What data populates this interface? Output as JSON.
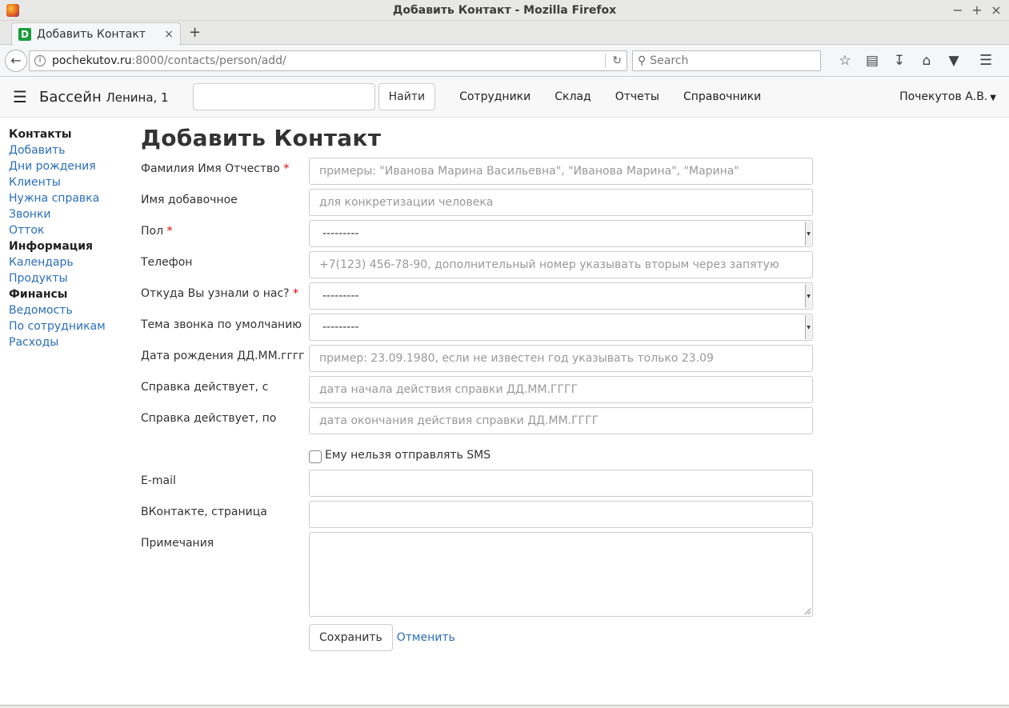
{
  "window": {
    "title": "Добавить Контакт - Mozilla Firefox",
    "controls": {
      "minimize": "−",
      "maximize": "+",
      "close": "×"
    }
  },
  "browser": {
    "tab": {
      "favicon_letter": "D",
      "title": "Добавить Контакт",
      "close": "×"
    },
    "new_tab": "+",
    "url": {
      "host": "pochekutov.ru",
      "path": ":8000/contacts/person/add/"
    },
    "search_placeholder": "Search",
    "icons": [
      "back-icon",
      "info-icon",
      "reload-icon",
      "search-icon",
      "bookmark-star-icon",
      "reading-list-icon",
      "download-icon",
      "home-icon",
      "pocket-icon",
      "menu-icon"
    ]
  },
  "site_nav": {
    "brand": "Бассейн",
    "brand_sub": "Ленина, 1",
    "search_value": "",
    "find_button": "Найти",
    "links": [
      "Сотрудники",
      "Склад",
      "Отчеты",
      "Справочники"
    ],
    "user": "Почекутов А.В."
  },
  "sidebar": {
    "groups": [
      {
        "heading": "Контакты",
        "items": [
          "Добавить",
          "Дни рождения",
          "Клиенты",
          "Нужна справка",
          "Звонки",
          "Отток"
        ]
      },
      {
        "heading": "Информация",
        "items": [
          "Календарь",
          "Продукты"
        ]
      },
      {
        "heading": "Финансы",
        "items": [
          "Ведомость",
          "По сотрудникам",
          "Расходы"
        ]
      }
    ]
  },
  "form": {
    "title": "Добавить Контакт",
    "required_mark": "*",
    "fields": {
      "fio": {
        "label": "Фамилия Имя Отчество",
        "placeholder": "примеры: \"Иванова Марина Васильевна\", \"Иванова Марина\", \"Марина\""
      },
      "name_extra": {
        "label": "Имя добавочное",
        "placeholder": "для конкретизации человека"
      },
      "gender": {
        "label": "Пол",
        "value": "---------"
      },
      "phone": {
        "label": "Телефон",
        "placeholder": "+7(123) 456-78-90, дополнительный номер указывать вторым через запятую"
      },
      "source": {
        "label": "Откуда Вы узнали о нас?",
        "value": "---------"
      },
      "call_topic": {
        "label": "Тема звонка по умолчанию",
        "value": "---------"
      },
      "birthday": {
        "label": "Дата рождения ДД.ММ.гггг",
        "placeholder": "пример: 23.09.1980, если не известен год указывать только 23.09"
      },
      "cert_from": {
        "label": "Справка действует, с",
        "placeholder": "дата начала действия справки ДД.ММ.ГГГГ"
      },
      "cert_to": {
        "label": "Справка действует, по",
        "placeholder": "дата окончания действия справки ДД.ММ.ГГГГ"
      },
      "no_sms": {
        "label": "Ему нельзя отправлять SMS"
      },
      "email": {
        "label": "E-mail",
        "value": ""
      },
      "vk": {
        "label": "ВКонтакте, страница",
        "value": ""
      },
      "notes": {
        "label": "Примечания",
        "value": ""
      }
    },
    "save_button": "Сохранить",
    "cancel_link": "Отменить"
  }
}
